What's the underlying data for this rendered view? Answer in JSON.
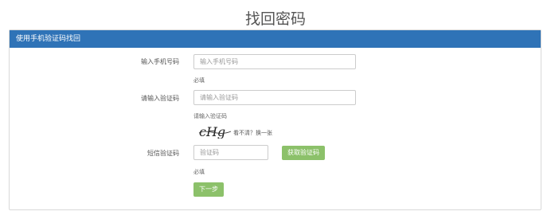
{
  "page_title": "找回密码",
  "panel": {
    "heading": "使用手机验证码找回"
  },
  "form": {
    "phone": {
      "label": "输入手机号码",
      "placeholder": "输入手机号码",
      "help": "必填"
    },
    "verify": {
      "label": "请输入验证码",
      "placeholder": "请输入验证码",
      "help": "请输入验证码"
    },
    "captcha": {
      "text": "cHg",
      "refresh_text": "看不清？换一张"
    },
    "sms": {
      "label": "短信验证码",
      "placeholder": "验证码",
      "help": "必填",
      "get_code_label": "获取验证码"
    },
    "next_label": "下一步"
  },
  "colors": {
    "heading_bg": "#2f73b7",
    "button_bg": "#8cc16a"
  }
}
